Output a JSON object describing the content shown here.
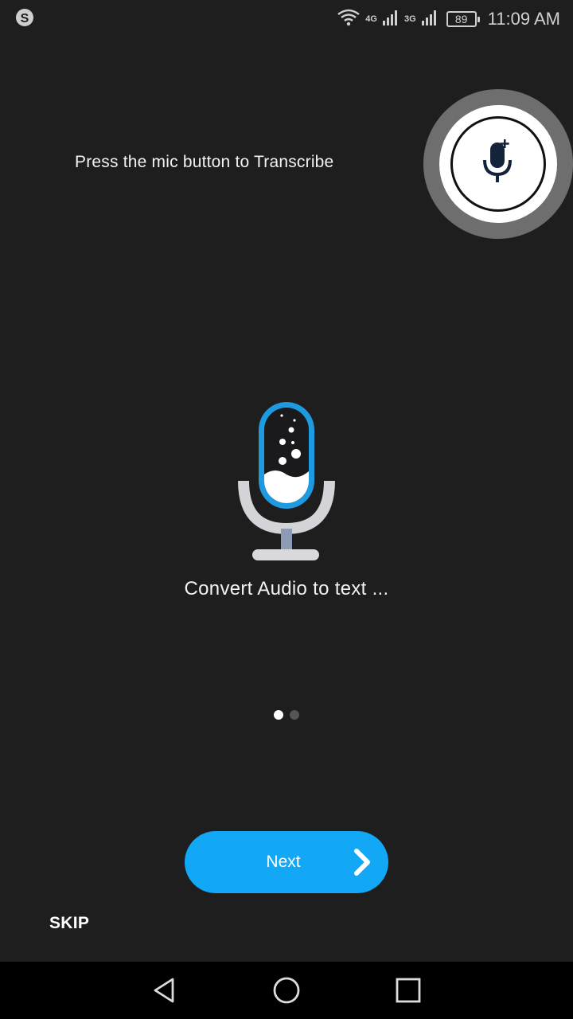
{
  "status_bar": {
    "app_icon": "skype-icon",
    "network_4g": "4G",
    "network_3g": "3G",
    "battery": "89",
    "time": "11:09 AM"
  },
  "onboarding": {
    "hint": "Press the mic button to Transcribe",
    "subtitle": "Convert Audio to text ...",
    "page_count": 2,
    "active_page": 1
  },
  "buttons": {
    "next_label": "Next",
    "skip_label": "SKIP"
  },
  "nav": {
    "back_icon": "back-icon",
    "home_icon": "home-icon",
    "recents_icon": "recents-icon"
  },
  "colors": {
    "background": "#1e1e1f",
    "accent": "#12a8f5",
    "mic_blue": "#1d9ae0"
  }
}
